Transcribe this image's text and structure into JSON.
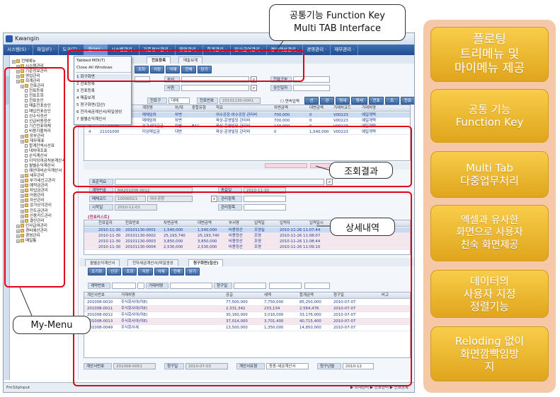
{
  "app": {
    "title": "Kwangin",
    "menu": [
      "시스템(S) ·",
      "파일(F) ·",
      "도구(T) ·",
      "창(W) ·",
      "시스템관리 ·",
      "기준정보관리 ·",
      "영업관리 ·",
      "회계관리 ·",
      "인사급여관리 ·",
      "경비예산관리 ·",
      "경영관리 ·",
      "재무관리 ·"
    ],
    "window_menu": {
      "items": [
        "Tabbed MDI(T)",
        "Close All Windows",
        "1 회구화면",
        "2 전표등록",
        "3 전표등록",
        "4 매출보계",
        "5 청구화면(집산)",
        "6 전자세금계산서(파일생성",
        "7 월별손익계산서"
      ]
    },
    "status_left": "Fm3/ipInput",
    "status_right": "▶ 회계관리 ▶ 전표관리 ▶ 전표등록"
  },
  "tree": {
    "items": [
      {
        "label": "전체메뉴",
        "level": 0,
        "kind": "root"
      },
      {
        "label": "시스템관리",
        "level": 1,
        "kind": "folder"
      },
      {
        "label": "기준정보관리",
        "level": 1,
        "kind": "folder"
      },
      {
        "label": "영업관리",
        "level": 1,
        "kind": "folder"
      },
      {
        "label": "회계관리",
        "level": 1,
        "kind": "folder"
      },
      {
        "label": "전표관리",
        "level": 2,
        "kind": "folder"
      },
      {
        "label": "전표등록",
        "level": 3,
        "kind": "page"
      },
      {
        "label": "전표조회",
        "level": 3,
        "kind": "page"
      },
      {
        "label": "전표승인",
        "level": 3,
        "kind": "page"
      },
      {
        "label": "매출전표승인",
        "level": 3,
        "kind": "page"
      },
      {
        "label": "매입전표승인",
        "level": 3,
        "kind": "page"
      },
      {
        "label": "선수식정산",
        "level": 3,
        "kind": "page"
      },
      {
        "label": "선급비용정산",
        "level": 3,
        "kind": "page"
      },
      {
        "label": "기간전표대체",
        "level": 3,
        "kind": "page"
      },
      {
        "label": "비용지불처리",
        "level": 3,
        "kind": "page"
      },
      {
        "label": "장부관리",
        "level": 2,
        "kind": "folder"
      },
      {
        "label": "재무제표",
        "level": 2,
        "kind": "folder"
      },
      {
        "label": "합계잔액시산표",
        "level": 3,
        "kind": "page"
      },
      {
        "label": "대차대조표",
        "level": 3,
        "kind": "page"
      },
      {
        "label": "손익계산서",
        "level": 3,
        "kind": "page"
      },
      {
        "label": "이익잉여금처분계산서",
        "level": 3,
        "kind": "page"
      },
      {
        "label": "월별손익계산서",
        "level": 3,
        "kind": "page"
      },
      {
        "label": "예산대비손익계산서",
        "level": 3,
        "kind": "page"
      },
      {
        "label": "세무관리",
        "level": 2,
        "kind": "folder"
      },
      {
        "label": "부가세신고관리",
        "level": 2,
        "kind": "folder"
      },
      {
        "label": "예적금관리",
        "level": 2,
        "kind": "folder"
      },
      {
        "label": "차입금관리",
        "level": 2,
        "kind": "folder"
      },
      {
        "label": "어음관리",
        "level": 2,
        "kind": "folder"
      },
      {
        "label": "자산관리",
        "level": 2,
        "kind": "folder"
      },
      {
        "label": "감가상각관리",
        "level": 2,
        "kind": "folder"
      },
      {
        "label": "전도금관리",
        "level": 2,
        "kind": "folder"
      },
      {
        "label": "신용카드관리",
        "level": 2,
        "kind": "folder"
      },
      {
        "label": "결산관리",
        "level": 2,
        "kind": "folder"
      },
      {
        "label": "인사급여관리",
        "level": 1,
        "kind": "folder"
      },
      {
        "label": "경비예산관리",
        "level": 1,
        "kind": "folder"
      },
      {
        "label": "경영관리",
        "level": 1,
        "kind": "folder"
      },
      {
        "label": "매일통",
        "level": 1,
        "kind": "folder"
      }
    ]
  },
  "work": {
    "tabs": [
      "전표등록",
      "매출보계"
    ],
    "top_buttons": [
      "조회",
      "저장",
      "삭제",
      "전체",
      "닫기"
    ],
    "search_form": {
      "labels": [
        "부서",
        "사원",
        "전표구분",
        "승인일자",
        "전표구분",
        "전표번호"
      ],
      "values": [
        "",
        "",
        "",
        "",
        "대체",
        "20101130-0001"
      ],
      "checkbox": "연속입력",
      "right_buttons": [
        "선택",
        "완료",
        "명세등록",
        "명세서조회",
        "전표삭제",
        "조기서",
        "전표인쇄"
      ]
    },
    "grid1": {
      "headers": [
        "순번",
        "계정코드",
        "계정명",
        "차/대",
        "종합유형",
        "적요",
        "차변금액",
        "대변금액",
        "거래처코드",
        "거래처명"
      ],
      "rows": [
        [
          "1",
          "43050000",
          "매체임차",
          "차변",
          "",
          "여수공장-여수공장 관리비",
          "700,000",
          "0",
          "V00223",
          "예일개택"
        ],
        [
          "2",
          "43050000",
          "매체임차",
          "차변",
          "",
          "육상-운영빌딩 관리비",
          "700,000",
          "0",
          "V00223",
          "예일개택"
        ],
        [
          "3",
          "11720000",
          "부가세대급금",
          "차변",
          "B11",
          "육상-운영빌딩 관리비",
          "140,000",
          "0",
          "V00223",
          "예일개택"
        ],
        [
          "4",
          "21101000",
          "미상매입금",
          "대변",
          "",
          "육상-운영빌딩 관리비",
          "0",
          "1,540,000",
          "V00223",
          "예일개택"
        ]
      ],
      "result_label": "조회결과"
    },
    "detail_form": {
      "labels": [
        "표준적요",
        "계약번호",
        "매체코드",
        "시작일",
        "종료일",
        "관리항목",
        "관리항목"
      ],
      "values": [
        "",
        "MA201006-0012",
        "10000021",
        "2010-11-01",
        "2010-11-30",
        "",
        ""
      ],
      "code_name": "여수공장",
      "section_title": "[전표리스트]",
      "detail_label": "상세내역"
    },
    "grid2": {
      "headers": [
        "전표일자",
        "전표번호",
        "차변금액",
        "대변금액",
        "부서명",
        "입력일",
        "입력자",
        "입력일시",
        "비고"
      ],
      "rows": [
        [
          "2010-11-30",
          "20101130-0001",
          "1,540,000",
          "1,540,000",
          "비용정산",
          "조영실",
          "2010-11-26 11:07:44",
          "",
          ""
        ],
        [
          "2010-11-30",
          "20101130-0002",
          "25,193,740",
          "25,193,740",
          "비용정산",
          "조영",
          "2010-11-26 11:08:07",
          "",
          ""
        ],
        [
          "2010-11-30",
          "20101130-0003",
          "3,850,000",
          "3,850,000",
          "비용정산",
          "조영",
          "2010-11-26 11:08:44",
          "",
          ""
        ],
        [
          "2010-11-30",
          "20101130-0004",
          "2,530,000",
          "2,530,000",
          "비용정산",
          "조영",
          "2010-11-26 11:09:10",
          "",
          ""
        ]
      ]
    },
    "lower_tabs": [
      "월별손익계산서",
      "전자세금계산서(파일생성",
      "청구화면(집산)"
    ],
    "lower_buttons": [
      "조기화",
      "신규",
      "조회",
      "저장",
      "삭제",
      "전체",
      "닫기"
    ],
    "lower_labels": [
      "계약번호",
      "거래처명",
      "청구일"
    ],
    "grid3": {
      "headers": [
        "계산서번호",
        "거래처명",
        "공급",
        "세액",
        "합계금액",
        "청구일",
        "비고"
      ],
      "rows": [
        [
          "201008-0010",
          "주식회사여(미E)",
          "77,500,000",
          "7,750,000",
          "85,250,000",
          "2010-07-07"
        ],
        [
          "201008-0011",
          "주식회사여(미E)",
          "2,331,342",
          "233,134",
          "2,564,476",
          "2010-07-07"
        ],
        [
          "201008-0012",
          "주식회사여(미E)",
          "30,160,000",
          "3,016,000",
          "33,176,000",
          "2010-07-07"
        ],
        [
          "201008-0013",
          "주식회사여(미E)",
          "37,014,000",
          "3,701,400",
          "40,715,400",
          "2010-07-07"
        ],
        [
          "201008-0049",
          "주식회사세",
          "13,500,000",
          "1,350,000",
          "14,850,000",
          "2010-07-07"
        ]
      ]
    },
    "bottom_labels": [
      "계산서번호",
      "청구일",
      "계산서유형",
      "청구년월"
    ],
    "bottom_values": [
      "201008-0051",
      "2010-07-03",
      "동종-세금계산서",
      "2010-12"
    ]
  },
  "callouts": {
    "function_key": "공통기능 Function Key\nMulti TAB Interface",
    "my_menu": "My-Menu"
  },
  "features": [
    "플로팅\n트리메뉴 및\n마이메뉴 제공",
    "공통 기능\nFunction Key",
    "Multi Tab\n다중업무처리",
    "엑셀과 유사한\n화면으로 사용자\n친숙 화면제공",
    "데이터의\n사용자 지정\n정렬기능",
    "Reloding 없이\n화면깜빡임방\n지"
  ],
  "colors": {
    "accent_red": "#e0001a",
    "panel_bg": "#f5c9a7",
    "feature_gold": "#e8b22a",
    "menubar_blue": "#2a5aa8"
  }
}
